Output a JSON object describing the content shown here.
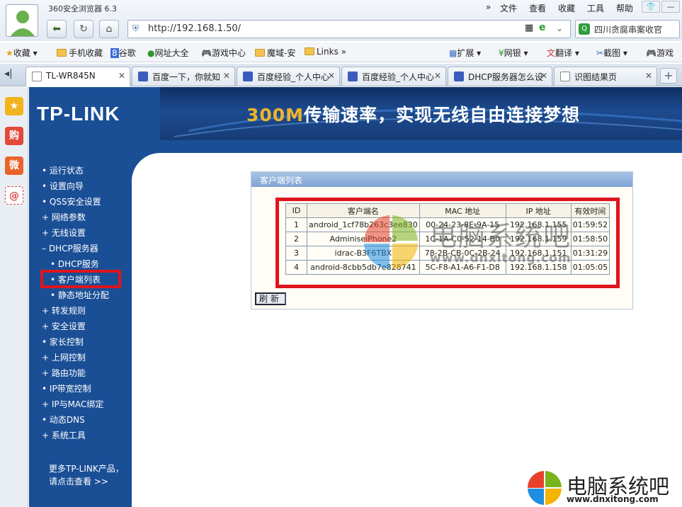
{
  "browser": {
    "title": "360安全浏览器 6.3",
    "menu": [
      "文件",
      "查看",
      "收藏",
      "工具",
      "帮助"
    ],
    "url": "http://192.168.1.50/",
    "search_text": "四川贪腐串案收官",
    "bookmarks": [
      "收藏",
      "手机收藏",
      "谷歌",
      "网址大全",
      "游戏中心",
      "魔域-安",
      "Links"
    ],
    "toolbar_right": [
      "扩展",
      "网银",
      "翻译",
      "截图",
      "游戏"
    ],
    "tabs": [
      "TL-WR845N",
      "百度一下，你就知",
      "百度经验_个人中心",
      "百度经验_个人中心",
      "DHCP服务器怎么设",
      "识图结果页"
    ]
  },
  "router": {
    "logo": "TP-LINK",
    "banner_hl": "300M",
    "banner": "传输速率，实现无线自由连接梦想",
    "menu": [
      "运行状态",
      "设置向导",
      "QSS安全设置",
      "网络参数",
      "无线设置",
      "DHCP服务器",
      "DHCP服务",
      "客户端列表",
      "静态地址分配",
      "转发规则",
      "安全设置",
      "家长控制",
      "上网控制",
      "路由功能",
      "IP带宽控制",
      "IP与MAC绑定",
      "动态DNS",
      "系统工具"
    ],
    "more_line1": "更多TP-LINK产品，",
    "more_line2": "请点击查看 >>",
    "panel_title": "客户端列表",
    "refresh": "刷新",
    "columns": [
      "ID",
      "客户端名",
      "MAC 地址",
      "IP 地址",
      "有效时间"
    ],
    "rows": [
      [
        "1",
        "android_1cf78b263c3ee830",
        "00-24-23-8E-9A-15",
        "192.168.1.155",
        "01:59:52"
      ],
      [
        "2",
        "AdminiseiPhone2",
        "1C-1A-C0-52-14-B0",
        "192.168.1.159",
        "01:58:50"
      ],
      [
        "3",
        "idrac-B3F6TBX",
        "78-2B-CB-0C-2B-24",
        "192.168.1.151",
        "01:31:29"
      ],
      [
        "4",
        "android-8cbb5db7e828741",
        "5C-F8-A1-A6-F1-D8",
        "192.168.1.158",
        "01:05:05"
      ]
    ]
  },
  "watermark": {
    "name": "电脑系统吧",
    "url": "www.dnxitong.com"
  },
  "colors": {
    "tp_blue": "#1a4f96",
    "highlight": "#e0141c"
  }
}
